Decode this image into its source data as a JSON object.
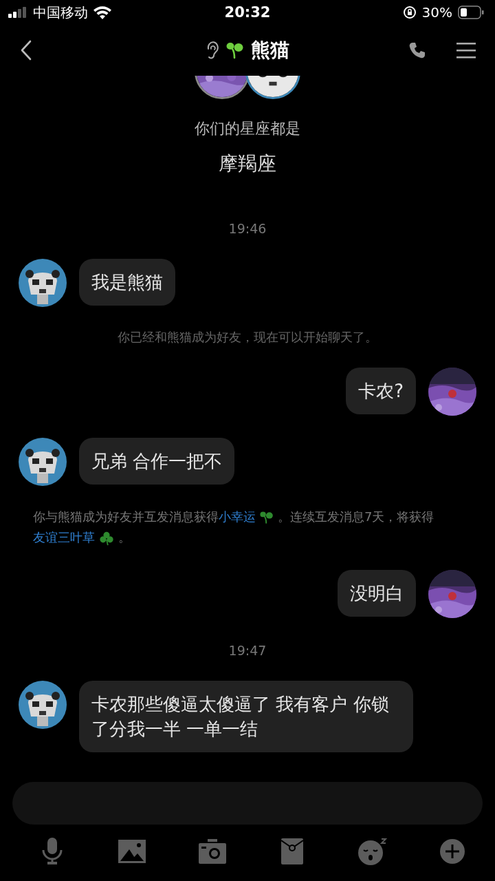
{
  "status_bar": {
    "carrier": "中国移动",
    "time": "20:32",
    "battery": "30%"
  },
  "nav": {
    "title": "熊猫"
  },
  "intro": {
    "label": "你们的星座都是",
    "zodiac": "摩羯座"
  },
  "messages": [
    {
      "kind": "time",
      "text": "19:46"
    },
    {
      "kind": "incoming",
      "text": "我是熊猫"
    },
    {
      "kind": "system",
      "text": "你已经和熊猫成为好友，现在可以开始聊天了。"
    },
    {
      "kind": "outgoing",
      "text": "卡农?"
    },
    {
      "kind": "incoming",
      "text": "兄弟 合作一把不"
    },
    {
      "kind": "notice",
      "parts": [
        {
          "text": "你与熊猫成为好友并互发消息获得",
          "link": false
        },
        {
          "text": "小幸运",
          "link": true
        },
        {
          "text": "。连续互发消息7天，将获得",
          "link": false
        },
        {
          "text": "友谊三叶草",
          "link": true
        },
        {
          "text": "。",
          "link": false
        }
      ]
    },
    {
      "kind": "outgoing",
      "text": "没明白"
    },
    {
      "kind": "time",
      "text": "19:47"
    },
    {
      "kind": "incoming",
      "text": "卡农那些傻逼太傻逼了 我有客户 你锁了分我一半 一单一结"
    }
  ]
}
